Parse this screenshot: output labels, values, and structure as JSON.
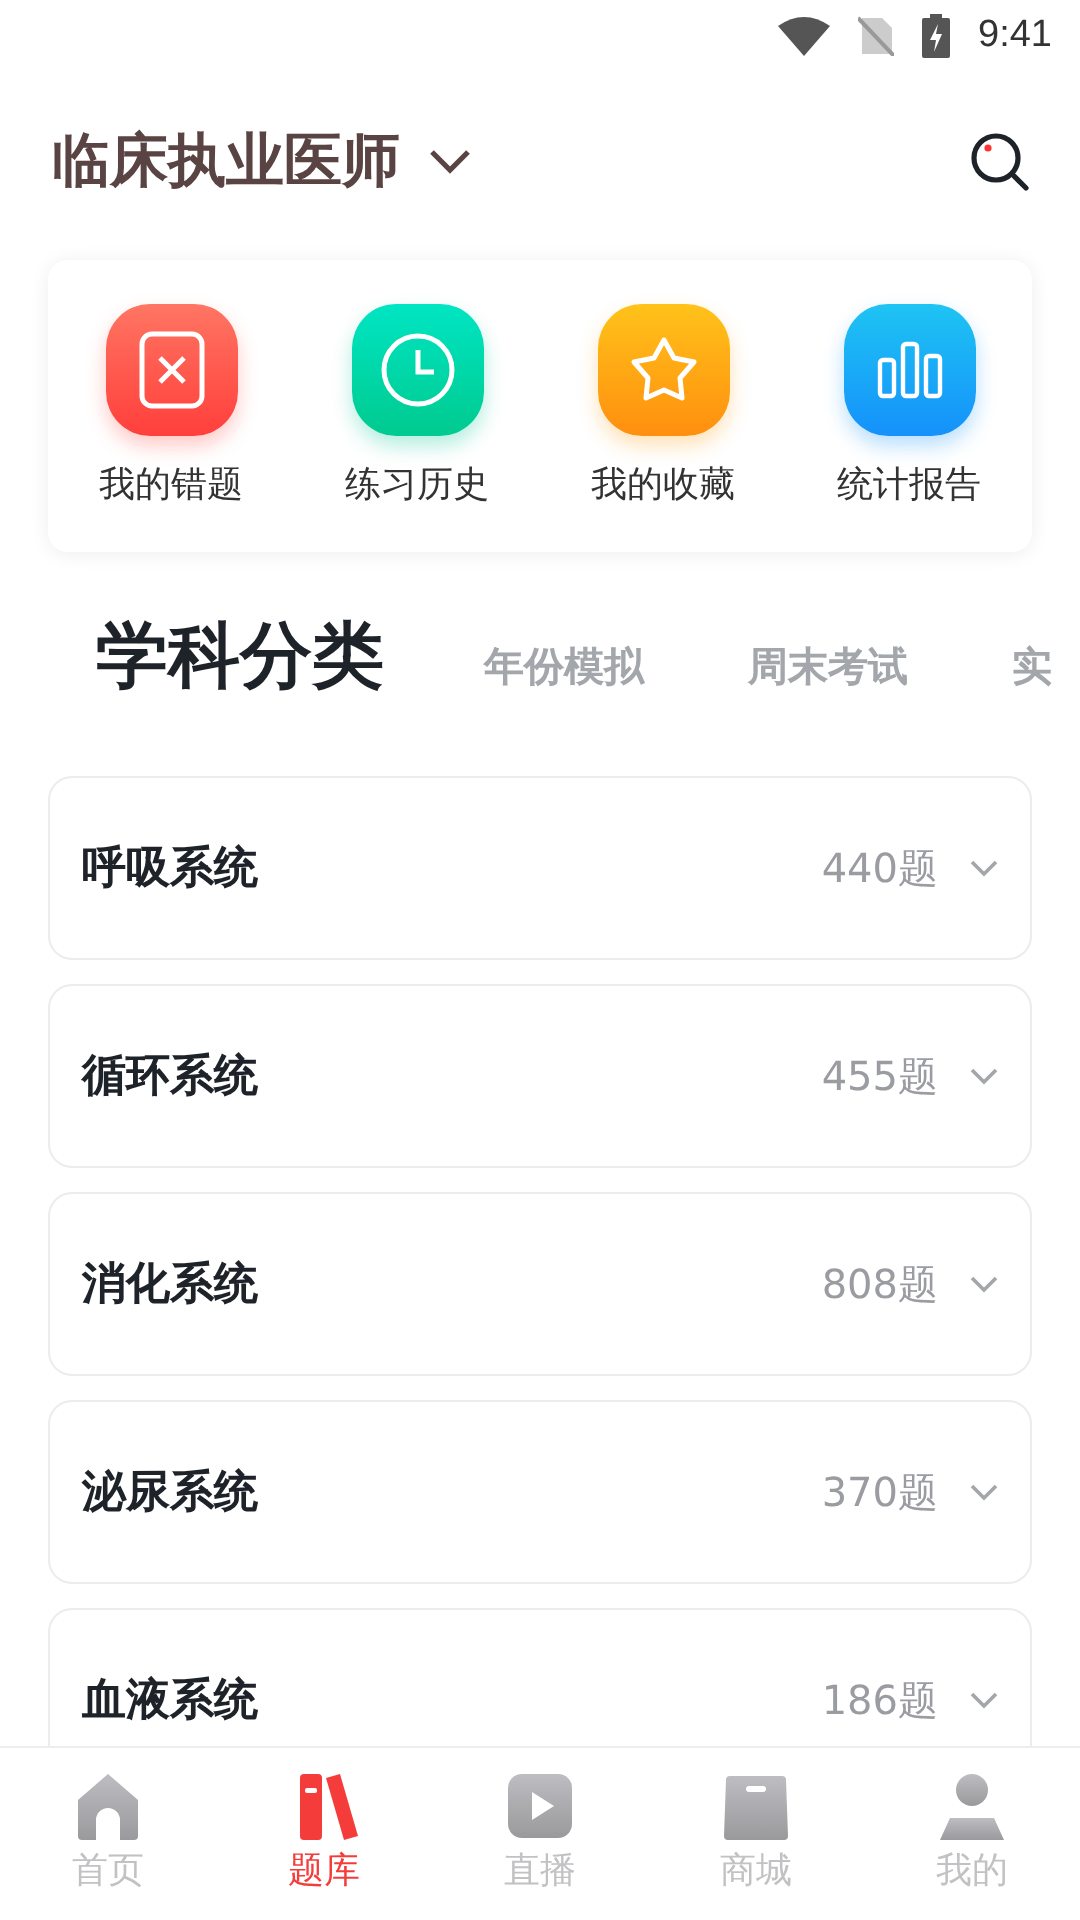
{
  "status_bar": {
    "time": "9:41"
  },
  "header": {
    "title": "临床执业医师"
  },
  "shortcuts": [
    {
      "kind": "wrong",
      "label": "我的错题"
    },
    {
      "kind": "history",
      "label": "练习历史"
    },
    {
      "kind": "favorite",
      "label": "我的收藏"
    },
    {
      "kind": "report",
      "label": "统计报告"
    }
  ],
  "tabs": [
    {
      "label": "学科分类",
      "selected": true
    },
    {
      "label": "年份模拟",
      "selected": false
    },
    {
      "label": "周末考试",
      "selected": false
    },
    {
      "label": "实",
      "selected": false
    }
  ],
  "subjects": [
    {
      "name": "呼吸系统",
      "count": "440题"
    },
    {
      "name": "循环系统",
      "count": "455题"
    },
    {
      "name": "消化系统",
      "count": "808题"
    },
    {
      "name": "泌尿系统",
      "count": "370题"
    },
    {
      "name": "血液系统",
      "count": "186题"
    }
  ],
  "nav": [
    {
      "kind": "home",
      "label": "首页",
      "selected": false
    },
    {
      "kind": "bank",
      "label": "题库",
      "selected": true
    },
    {
      "kind": "live",
      "label": "直播",
      "selected": false
    },
    {
      "kind": "shop",
      "label": "商城",
      "selected": false
    },
    {
      "kind": "me",
      "label": "我的",
      "selected": false
    }
  ]
}
